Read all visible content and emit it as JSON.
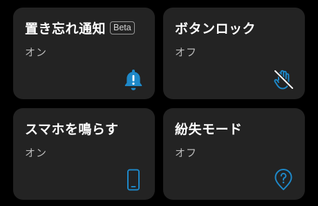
{
  "colors": {
    "background": "#000000",
    "card": "#232323",
    "accent": "#1e88c8",
    "status_text": "#bdbdbd"
  },
  "cards": [
    {
      "title": "置き忘れ通知",
      "badge": "Beta",
      "status": "オン",
      "icon": "bell-icon"
    },
    {
      "title": "ボタンロック",
      "status": "オフ",
      "icon": "hand-blocked-icon"
    },
    {
      "title": "スマホを鳴らす",
      "status": "オン",
      "icon": "smartphone-icon"
    },
    {
      "title": "紛失モード",
      "status": "オフ",
      "icon": "location-question-icon"
    }
  ]
}
